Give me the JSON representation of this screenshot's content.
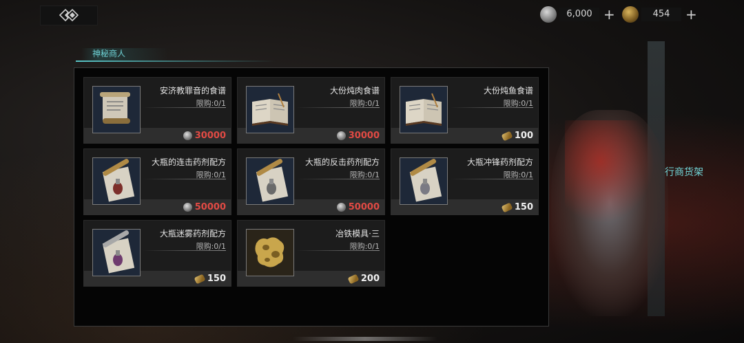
{
  "header": {
    "currencies": [
      {
        "icon": "silver-coin-icon",
        "value": "6,000",
        "plus": "+"
      },
      {
        "icon": "gold-leaf-icon",
        "value": "454",
        "plus": "+"
      }
    ]
  },
  "tab": {
    "label": "神秘商人"
  },
  "side": {
    "shelf_label": "行商货架"
  },
  "shop": {
    "items": [
      {
        "name": "安济教罪音的食谱",
        "limit": "限购:0/1",
        "price": "30000",
        "currency": "silver",
        "price_color": "#e14a44",
        "icon": "scroll-icon"
      },
      {
        "name": "大份炖肉食谱",
        "limit": "限购:0/1",
        "price": "30000",
        "currency": "silver",
        "price_color": "#e14a44",
        "icon": "open-book-icon"
      },
      {
        "name": "大份炖鱼食谱",
        "limit": "限购:0/1",
        "price": "100",
        "currency": "gold",
        "price_color": "#f0f0f0",
        "icon": "open-book-icon"
      },
      {
        "name": "大瓶的连击药剂配方",
        "limit": "限购:0/1",
        "price": "50000",
        "currency": "silver",
        "price_color": "#e14a44",
        "icon": "potion-scroll-icon"
      },
      {
        "name": "大瓶的反击药剂配方",
        "limit": "限购:0/1",
        "price": "50000",
        "currency": "silver",
        "price_color": "#e14a44",
        "icon": "potion-scroll-icon"
      },
      {
        "name": "大瓶冲锋药剂配方",
        "limit": "限购:0/1",
        "price": "150",
        "currency": "gold",
        "price_color": "#f0f0f0",
        "icon": "potion-scroll-icon"
      },
      {
        "name": "大瓶迷雾药剂配方",
        "limit": "限购:0/1",
        "price": "150",
        "currency": "gold",
        "price_color": "#f0f0f0",
        "icon": "potion-scroll-icon"
      },
      {
        "name": "冶铁模具·三",
        "limit": "限购:0/1",
        "price": "200",
        "currency": "gold",
        "price_color": "#f0f0f0",
        "icon": "iron-mold-icon"
      }
    ]
  },
  "colors": {
    "accent": "#6fd3d6",
    "price_red": "#e14a44"
  }
}
